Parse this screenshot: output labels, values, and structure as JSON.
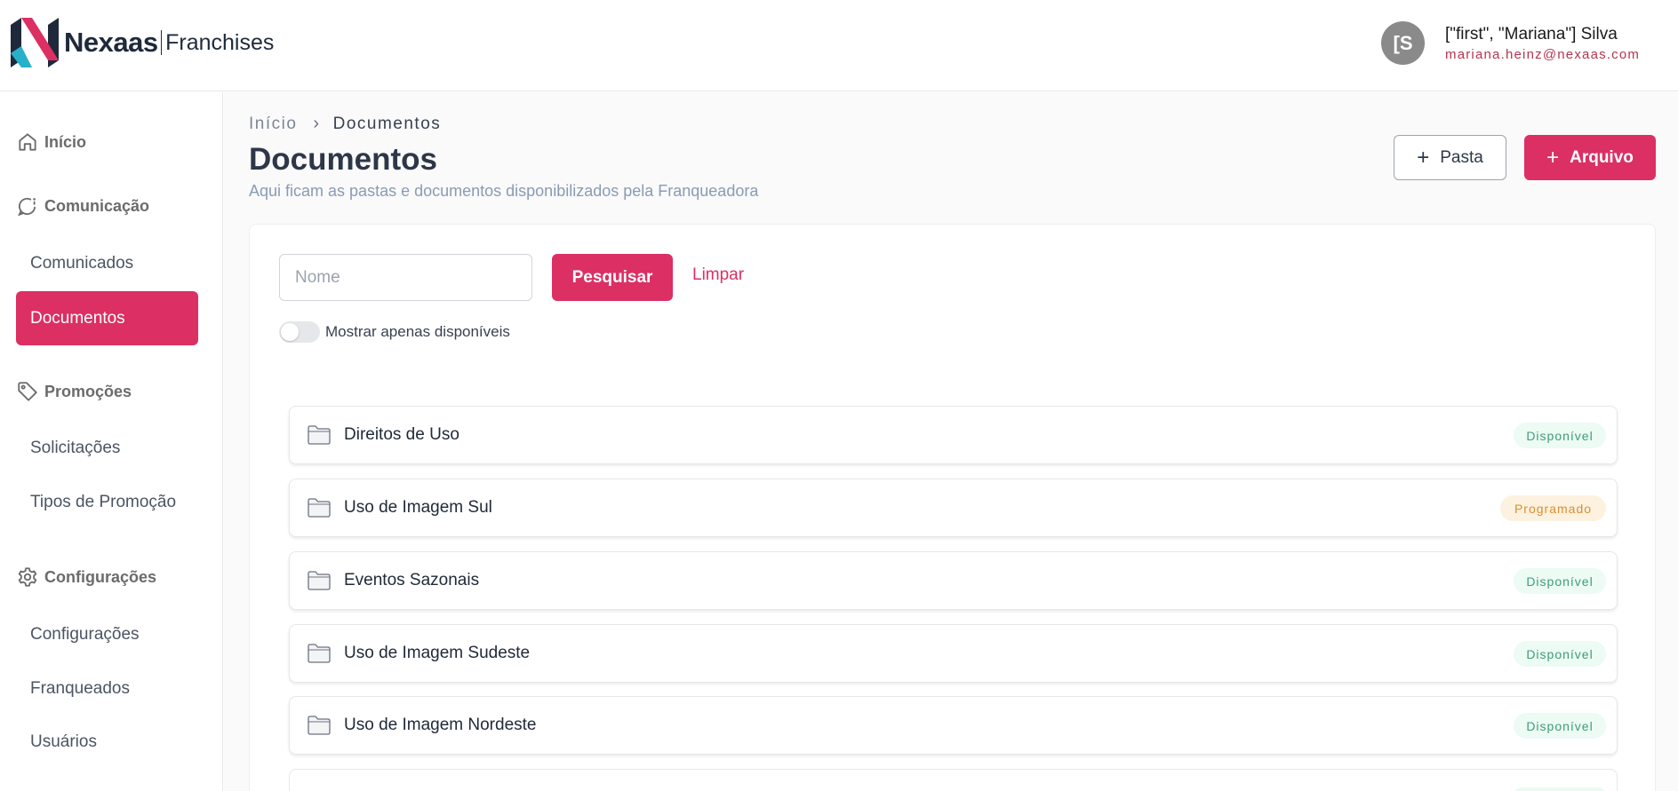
{
  "header": {
    "logo_name": "Nexaas",
    "logo_sub": "Franchises",
    "user": {
      "avatar_initials": "[S",
      "name": "[\"first\", \"Mariana\"] Silva",
      "email": "mariana.heinz@nexaas.com"
    }
  },
  "sidebar": {
    "sections": [
      {
        "label": "Início",
        "icon": "home-icon"
      },
      {
        "label": "Comunicação",
        "icon": "chat-icon"
      },
      {
        "label": "Promoções",
        "icon": "tag-icon"
      },
      {
        "label": "Configurações",
        "icon": "gear-icon"
      }
    ],
    "items": {
      "comunicados": "Comunicados",
      "documentos": "Documentos",
      "solicitacoes": "Solicitações",
      "tipos_promocao": "Tipos de Promoção",
      "configuracoes": "Configurações",
      "franqueados": "Franqueados",
      "usuarios": "Usuários"
    },
    "active_item": "Documentos"
  },
  "breadcrumb": {
    "home": "Início",
    "current": "Documentos"
  },
  "page": {
    "title": "Documentos",
    "subtitle": "Aqui ficam as pastas e documentos disponibilizados pela Franqueadora",
    "btn_pasta": "Pasta",
    "btn_arquivo": "Arquivo"
  },
  "filters": {
    "name_placeholder": "Nome",
    "name_value": "",
    "search_label": "Pesquisar",
    "clear_label": "Limpar",
    "toggle_label": "Mostrar apenas disponíveis",
    "toggle_on": false
  },
  "folders": [
    {
      "name": "Direitos de Uso",
      "status": "Disponível",
      "status_type": "available"
    },
    {
      "name": "Uso de Imagem Sul",
      "status": "Programado",
      "status_type": "scheduled"
    },
    {
      "name": "Eventos Sazonais",
      "status": "Disponível",
      "status_type": "available"
    },
    {
      "name": "Uso de Imagem Sudeste",
      "status": "Disponível",
      "status_type": "available"
    },
    {
      "name": "Uso de Imagem Nordeste",
      "status": "Disponível",
      "status_type": "available"
    }
  ],
  "colors": {
    "brand": "#dc2f63",
    "available_bg": "#ecfbf4",
    "available_text": "#3f9c78",
    "scheduled_bg": "#fdf1e0",
    "scheduled_text": "#d9902c"
  }
}
